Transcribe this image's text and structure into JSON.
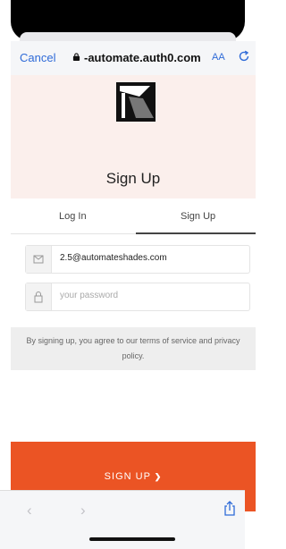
{
  "browser": {
    "cancel_label": "Cancel",
    "domain": "-automate.auth0.com",
    "text_size_label": "AA"
  },
  "header": {
    "title": "Sign Up"
  },
  "tabs": [
    {
      "label": "Log In",
      "active": false
    },
    {
      "label": "Sign Up",
      "active": true
    }
  ],
  "form": {
    "email_value": "2.5@automateshades.com",
    "password_placeholder": "your password"
  },
  "terms_text": "By signing up, you agree to our terms of service and privacy policy.",
  "submit": {
    "label": "SIGN UP",
    "chevron": "❯"
  },
  "toolbar": {
    "back": "‹",
    "forward": "›"
  },
  "colors": {
    "accent": "#eb5424",
    "link": "#2f6bd8",
    "header_bg": "#fbefec"
  }
}
